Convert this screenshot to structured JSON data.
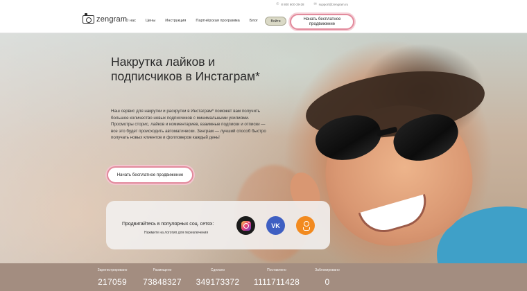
{
  "header": {
    "phone": "8 800 600-39-28",
    "email": "support@zengram.ru",
    "logo_text": "zengram",
    "nav": [
      "О нас",
      "Цены",
      "Инструкция",
      "Партнёрская программа",
      "Блог"
    ],
    "login_label": "Войти",
    "cta_label": "Начать бесплатное продвижение"
  },
  "hero": {
    "title": "Накрутка лайков и подписчиков в Инстаграм*",
    "description": "Наш сервис для накрутки и раскрутки в Инстаграм* поможет вам получить большое количество новых подписчиков с минимальными усилиями. Просмотры сторис, лайков и комментариев, взаимные подписки и отписки — все это будет происходить автоматически. Зенграм — лучший способ быстро получать новых клиентов и фолловеров каждый день!",
    "cta_label": "Начать бесплатное продвижение"
  },
  "social": {
    "title": "Продвигайтесь в популярных соц. сетях:",
    "subtitle": "Нажмите на логотип для переключения",
    "networks": [
      {
        "name": "Instagram",
        "icon": "instagram-icon"
      },
      {
        "name": "VK",
        "icon": "vk-icon",
        "glyph": "VK"
      },
      {
        "name": "Odnoklassniki",
        "icon": "odnoklassniki-icon"
      }
    ]
  },
  "stats": [
    {
      "label": "Зарегистрировано",
      "value": "217059"
    },
    {
      "label": "Размещено",
      "value": "73848327"
    },
    {
      "label": "Сделано",
      "value": "349173372"
    },
    {
      "label": "Поставлено",
      "value": "1111711428"
    },
    {
      "label": "Заблокировано",
      "value": "0"
    }
  ],
  "colors": {
    "cta_border": "#e28a9c",
    "login_bg": "#dad9c6",
    "vk": "#3f5fc2",
    "ok": "#f28a1f",
    "stats_bg": "#9c8476"
  }
}
